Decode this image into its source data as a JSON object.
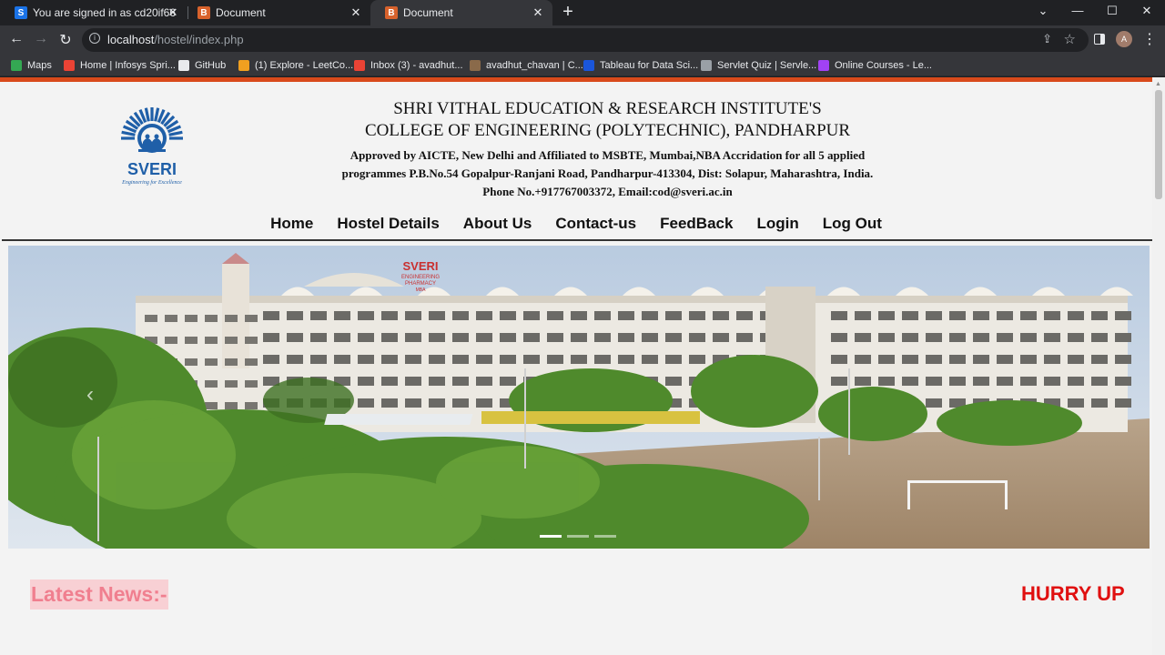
{
  "browser": {
    "tabs": [
      {
        "title": "You are signed in as cd20if66",
        "favicon": "S",
        "color": "#1a73e8"
      },
      {
        "title": "Document",
        "favicon": "B",
        "color": "#d8622c"
      },
      {
        "title": "Document",
        "favicon": "B",
        "color": "#d8622c"
      }
    ],
    "url_host": "localhost",
    "url_path": "/hostel/index.php",
    "avatar_initial": "A",
    "bookmarks": [
      {
        "label": "Maps",
        "icon": "maps-icon",
        "color": "#34a853"
      },
      {
        "label": "Home | Infosys Spri...",
        "icon": "infosys-icon",
        "color": "#ea4335"
      },
      {
        "label": "GitHub",
        "icon": "github-icon",
        "color": "#e8eaed"
      },
      {
        "label": "(1) Explore - LeetCo...",
        "icon": "leetcode-icon",
        "color": "#f0a020"
      },
      {
        "label": "Inbox (3) - avadhut...",
        "icon": "gmail-icon",
        "color": "#ea4335"
      },
      {
        "label": "avadhut_chavan | C...",
        "icon": "codechef-icon",
        "color": "#8a6a4a"
      },
      {
        "label": "Tableau for Data Sci...",
        "icon": "tableau-icon",
        "color": "#1a56db"
      },
      {
        "label": "Servlet Quiz | Servle...",
        "icon": "globe-icon",
        "color": "#9aa0a6"
      },
      {
        "label": "Online Courses - Le...",
        "icon": "course-icon",
        "color": "#a142f4"
      }
    ]
  },
  "header": {
    "line1": "SHRI VITHAL EDUCATION & RESEARCH INSTITUTE'S",
    "line2": "COLLEGE OF ENGINEERING (POLYTECHNIC), PANDHARPUR",
    "address": "Approved by AICTE, New Delhi and Affiliated to MSBTE, Mumbai,NBA Accridation for all 5 applied programmes P.B.No.54 Gopalpur-Ranjani Road, Pandharpur-413304, Dist: Solapur, Maharashtra, India. Phone No.+917767003372, Email:cod@sveri.ac.in",
    "logo_text": "SVERI",
    "logo_tagline": "Engineering for Excellence"
  },
  "nav": [
    "Home",
    "Hostel Details",
    "About Us",
    "Contact-us",
    "FeedBack",
    "Login",
    "Log Out"
  ],
  "slider": {
    "building_sign": "SVERI",
    "building_sub1": "ENGINEERING",
    "building_sub2": "PHARMACY",
    "building_sub3": "MBA",
    "slide_count": 3,
    "active_slide": 1
  },
  "news": {
    "label": "Latest News:-",
    "hurry": "HURRY UP"
  }
}
